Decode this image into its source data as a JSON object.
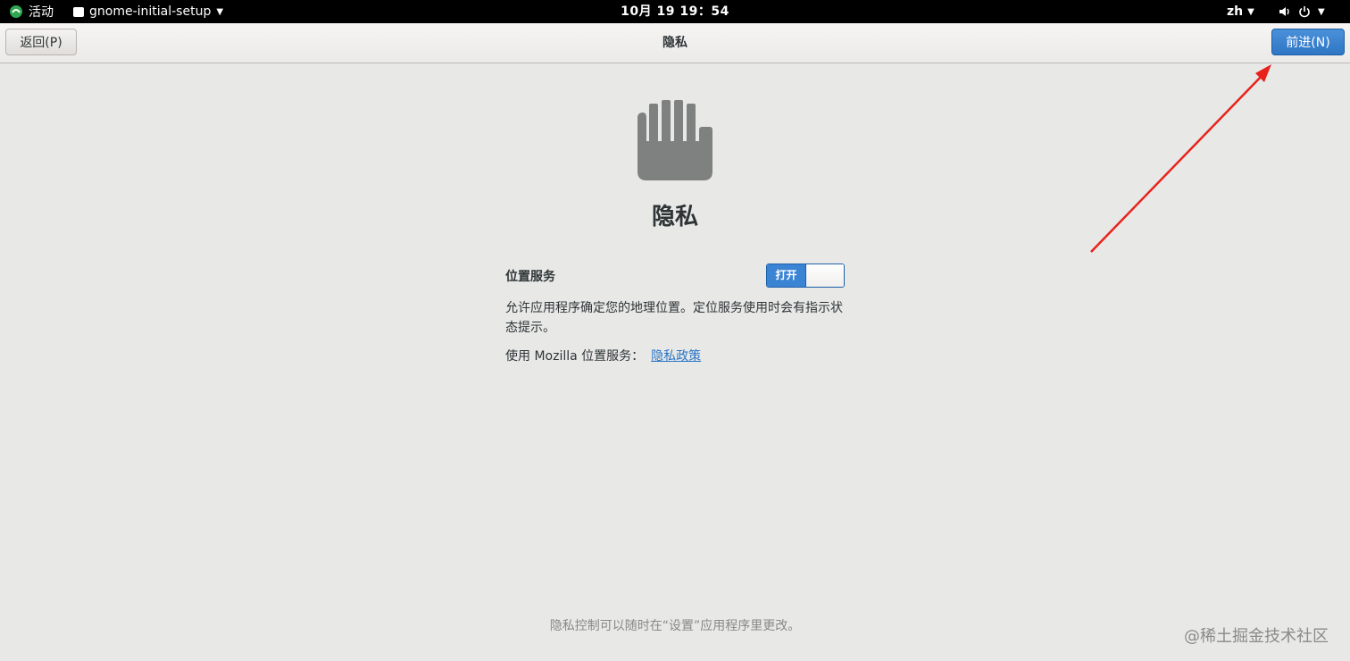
{
  "topbar": {
    "activities_label": "活动",
    "app_name": "gnome-initial-setup",
    "clock": "10月 19  19：54",
    "language": "zh",
    "icons": [
      "volume-icon",
      "power-icon"
    ]
  },
  "headerbar": {
    "back_label": "返回(P)",
    "title": "隐私",
    "next_label": "前进(N)"
  },
  "main": {
    "icon": "hand-icon",
    "heading": "隐私",
    "location": {
      "label": "位置服务",
      "switch_state": "打开",
      "enabled": true
    },
    "description": "允许应用程序确定您的地理位置。定位服务使用时会有指示状态提示。",
    "mozilla_text": "使用 Mozilla 位置服务：",
    "policy_link": "隐私政策"
  },
  "footer": {
    "note": "隐私控制可以随时在“设置”应用程序里更改。"
  },
  "watermark": "@稀土掘金技术社区",
  "colors": {
    "accent": "#3b84d4",
    "background": "#e8e8e7",
    "annotation_arrow": "#e8221b"
  }
}
